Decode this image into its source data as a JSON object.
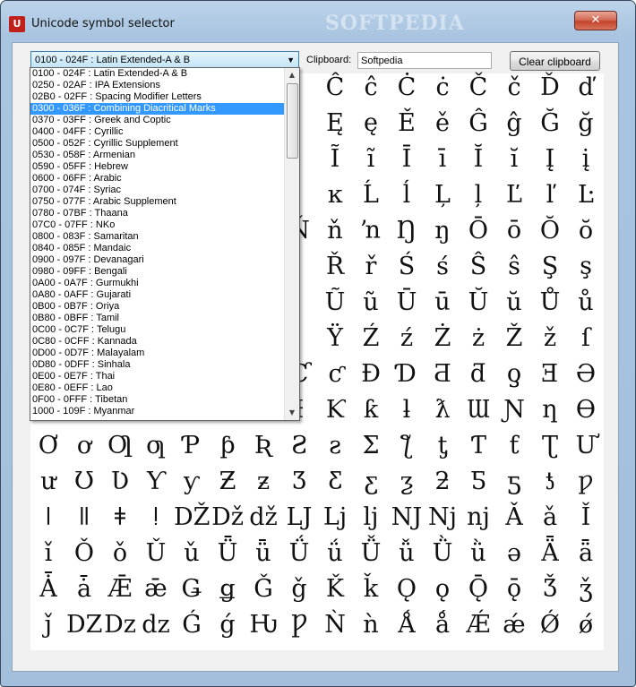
{
  "window": {
    "title": "Unicode symbol selector",
    "app_icon_text": "U",
    "watermark": "SOFTPEDIA",
    "close_glyph": "✕"
  },
  "toolbar": {
    "selected_block": "0100 - 024F :  Latin Extended-A & B",
    "clipboard_label": "Clipboard:",
    "clipboard_value": "Softpedia",
    "clear_button": "Clear clipboard"
  },
  "dropdown": {
    "selected_index": 3,
    "items": [
      "0100 - 024F :  Latin Extended-A & B",
      "0250 - 02AF :  IPA Extensions",
      "02B0 - 02FF :  Spacing Modifier Letters",
      "0300 - 036F :  Combining Diacritical Marks",
      "0370 - 03FF :  Greek and Coptic",
      "0400 - 04FF :  Cyrillic",
      "0500 - 052F :  Cyrillic Supplement",
      "0530 - 058F :  Armenian",
      "0590 - 05FF :  Hebrew",
      "0600 - 06FF :  Arabic",
      "0700 - 074F :  Syriac",
      "0750 - 077F :  Arabic Supplement",
      "0780 - 07BF :  Thaana",
      "07C0 - 07FF :  NKo",
      "0800 - 083F :  Samaritan",
      "0840 - 085F :  Mandaic",
      "0900 - 097F :  Devanagari",
      "0980 - 09FF :  Bengali",
      "0A00 - 0A7F :  Gurmukhi",
      "0A80 - 0AFF :  Gujarati",
      "0B00 - 0B7F :  Oriya",
      "0B80 - 0BFF :  Tamil",
      "0C00 - 0C7F :  Telugu",
      "0C80 - 0CFF :  Kannada",
      "0D00 - 0D7F :  Malayalam",
      "0D80 - 0DFF :  Sinhala",
      "0E00 - 0E7F :  Thai",
      "0E80 - 0EFF :  Lao",
      "0F00 - 0FFF :  Tibetan",
      "1000 - 109F :  Myanmar"
    ]
  },
  "glyph_rows": [
    {
      "start": 8,
      "chars": [
        "Ĉ",
        "ĉ",
        "Ċ",
        "ċ",
        "Č",
        "č",
        "Ď",
        "ď"
      ]
    },
    {
      "start": 8,
      "chars": [
        "Ę",
        "ę",
        "Ě",
        "ě",
        "Ĝ",
        "ĝ",
        "Ğ",
        "ğ"
      ]
    },
    {
      "start": 8,
      "chars": [
        "Ĩ",
        "ĩ",
        "Ī",
        "ī",
        "Ĭ",
        "ĭ",
        "Į",
        "į"
      ]
    },
    {
      "start": 8,
      "chars": [
        "ĸ",
        "Ĺ",
        "ĺ",
        "Ļ",
        "ļ",
        "Ľ",
        "ľ",
        "Ŀ"
      ]
    },
    {
      "start": 7,
      "chars": [
        "Ň",
        "ň",
        "ŉ",
        "Ŋ",
        "ŋ",
        "Ō",
        "ō",
        "Ŏ",
        "ŏ"
      ]
    },
    {
      "start": 8,
      "chars": [
        "Ř",
        "ř",
        "Ś",
        "ś",
        "Ŝ",
        "ŝ",
        "Ş",
        "ş"
      ]
    },
    {
      "start": 8,
      "chars": [
        "Ũ",
        "ũ",
        "Ū",
        "ū",
        "Ŭ",
        "ŭ",
        "Ů",
        "ů"
      ]
    },
    {
      "start": 8,
      "chars": [
        "Ÿ",
        "Ź",
        "ź",
        "Ż",
        "ż",
        "Ž",
        "ž",
        "ſ"
      ]
    },
    {
      "start": 7,
      "chars": [
        "Ƈ",
        "ƈ",
        "Ɖ",
        "Ɗ",
        "Ƌ",
        "ƌ",
        "ƍ",
        "Ǝ",
        "Ə"
      ]
    },
    {
      "start": 3,
      "chars": [
        "Ɠ",
        "Ɣ",
        "ƕ",
        "Ɩ",
        "Ɨ",
        "Ƙ",
        "ƙ",
        "ƚ",
        "ƛ",
        "Ɯ",
        "Ɲ",
        "ƞ",
        "Ɵ"
      ]
    },
    {
      "start": 0,
      "chars": [
        "Ơ",
        "ơ",
        "Ƣ",
        "ƣ",
        "Ƥ",
        "ƥ",
        "Ʀ",
        "Ƨ",
        "ƨ",
        "Ʃ",
        "ƪ",
        "ƫ",
        "Ƭ",
        "ƭ",
        "Ʈ",
        "Ư"
      ]
    },
    {
      "start": 0,
      "chars": [
        "ư",
        "Ʊ",
        "Ʋ",
        "Ƴ",
        "ƴ",
        "Ƶ",
        "ƶ",
        "Ʒ",
        "Ƹ",
        "ƹ",
        "ƺ",
        "ƻ",
        "Ƽ",
        "ƽ",
        "ƾ",
        "ƿ"
      ]
    },
    {
      "start": 0,
      "chars": [
        "ǀ",
        "ǁ",
        "ǂ",
        "ǃ",
        "Ǆ",
        "ǅ",
        "ǆ",
        "Ǉ",
        "ǈ",
        "ǉ",
        "Ǌ",
        "ǋ",
        "ǌ",
        "Ǎ",
        "ǎ",
        "Ǐ"
      ]
    },
    {
      "start": 0,
      "chars": [
        "ǐ",
        "Ǒ",
        "ǒ",
        "Ǔ",
        "ǔ",
        "Ǖ",
        "ǖ",
        "Ǘ",
        "ǘ",
        "Ǚ",
        "ǚ",
        "Ǜ",
        "ǜ",
        "ǝ",
        "Ǟ",
        "ǟ"
      ]
    },
    {
      "start": 0,
      "chars": [
        "Ǡ",
        "ǡ",
        "Ǣ",
        "ǣ",
        "Ǥ",
        "ǥ",
        "Ǧ",
        "ǧ",
        "Ǩ",
        "ǩ",
        "Ǫ",
        "ǫ",
        "Ǭ",
        "ǭ",
        "Ǯ",
        "ǯ"
      ]
    },
    {
      "start": 0,
      "chars": [
        "ǰ",
        "Ǳ",
        "ǲ",
        "ǳ",
        "Ǵ",
        "ǵ",
        "Ƕ",
        "Ƿ",
        "Ǹ",
        "ǹ",
        "Ǻ",
        "ǻ",
        "Ǽ",
        "ǽ",
        "Ǿ",
        "ǿ"
      ]
    }
  ]
}
